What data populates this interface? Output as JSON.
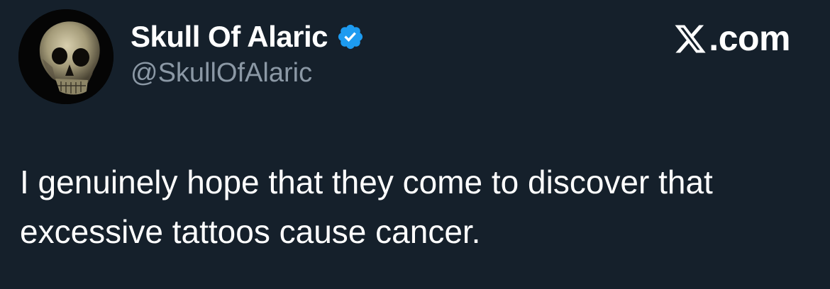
{
  "author": {
    "display_name": "Skull Of Alaric",
    "handle": "@SkullOfAlaric",
    "verified": true,
    "avatar_icon": "skull-icon",
    "badge_color": "#1d9bf0"
  },
  "brand": {
    "logo_icon": "x-logo-icon",
    "suffix": ".com"
  },
  "tweet": {
    "text": "I genuinely hope that they come to discover that excessive tattoos cause cancer."
  },
  "colors": {
    "background": "#15202b",
    "text_primary": "#ffffff",
    "text_secondary": "#8b98a5"
  }
}
